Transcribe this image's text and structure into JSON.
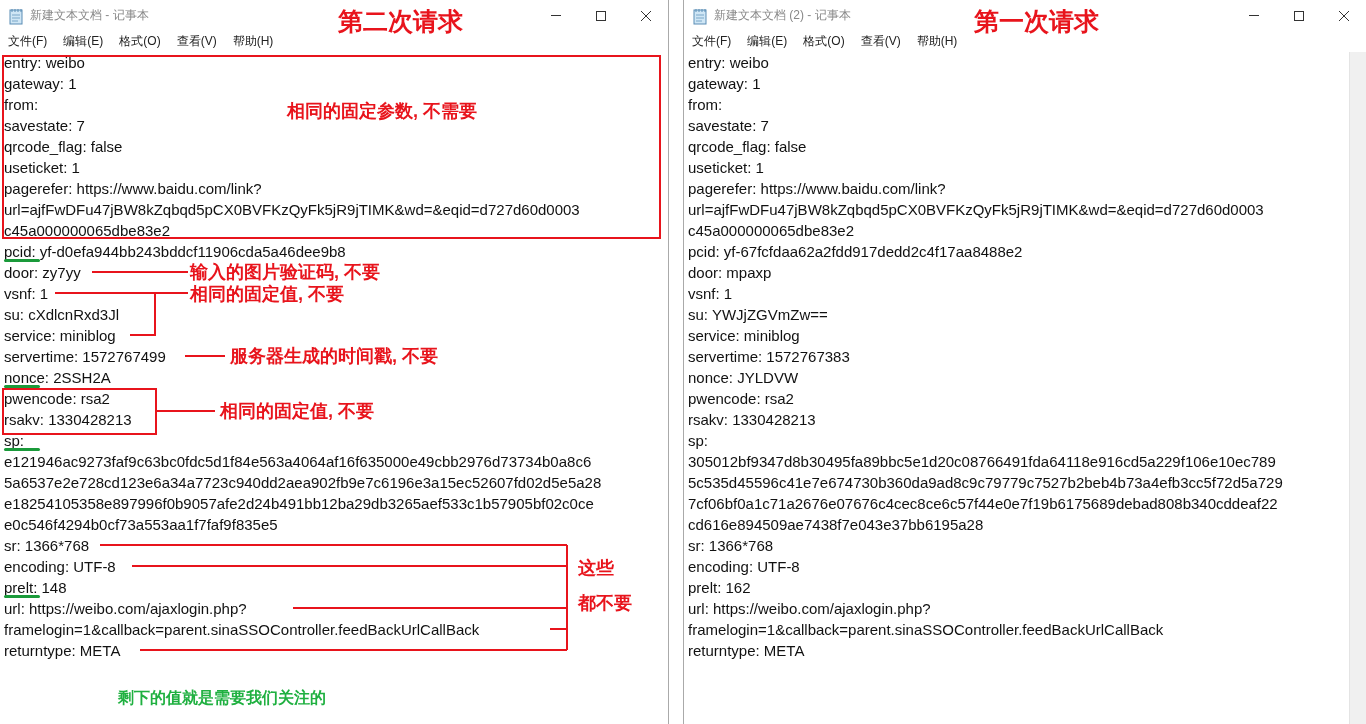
{
  "windows": [
    {
      "title": "新建文本文档 - 记事本",
      "heading": "第二次请求",
      "menu": [
        "文件(F)",
        "编辑(E)",
        "格式(O)",
        "查看(V)",
        "帮助(H)"
      ],
      "lines": [
        {
          "text": "entry: weibo",
          "underlined": false
        },
        {
          "text": "gateway: 1",
          "underlined": false
        },
        {
          "text": "from:",
          "underlined": false
        },
        {
          "text": "savestate: 7",
          "underlined": false
        },
        {
          "text": "qrcode_flag: false",
          "underlined": false
        },
        {
          "text": "useticket: 1",
          "underlined": false
        },
        {
          "text": "pagerefer: https://www.baidu.com/link?",
          "underlined": false
        },
        {
          "text": "url=ajfFwDFu47jBW8kZqbqd5pCX0BVFKzQyFk5jR9jTIMK&wd=&eqid=d727d60d0003",
          "underlined": false
        },
        {
          "text": "c45a000000065dbe83e2",
          "underlined": false
        },
        {
          "text": "pcid: yf-d0efa944bb243bddcf11906cda5a46dee9b8",
          "underlined": true
        },
        {
          "text": "door: zy7yy",
          "underlined": false
        },
        {
          "text": "vsnf: 1",
          "underlined": false
        },
        {
          "text": "su: cXdlcnRxd3Jl",
          "underlined": false
        },
        {
          "text": "service: miniblog",
          "underlined": false
        },
        {
          "text": "servertime: 1572767499",
          "underlined": false
        },
        {
          "text": "nonce: 2SSH2A",
          "underlined": true
        },
        {
          "text": "pwencode: rsa2",
          "underlined": false
        },
        {
          "text": "rsakv: 1330428213",
          "underlined": false
        },
        {
          "text": "sp:",
          "underlined": true
        },
        {
          "text": "e121946ac9273faf9c63bc0fdc5d1f84e563a4064af16f635000e49cbb2976d73734b0a8c6",
          "underlined": false
        },
        {
          "text": "5a6537e2e728cd123e6a34a7723c940dd2aea902fb9e7c6196e3a15ec52607fd02d5e5a28",
          "underlined": false
        },
        {
          "text": "e18254105358e897996f0b9057afe2d24b491bb12ba29db3265aef533c1b57905bf02c0ce",
          "underlined": false
        },
        {
          "text": "e0c546f4294b0cf73a553aa1f7faf9f835e5",
          "underlined": false
        },
        {
          "text": "sr: 1366*768",
          "underlined": false
        },
        {
          "text": "encoding: UTF-8",
          "underlined": false
        },
        {
          "text": "prelt: 148",
          "underlined": true
        },
        {
          "text": "url: https://weibo.com/ajaxlogin.php?",
          "underlined": false
        },
        {
          "text": "framelogin=1&callback=parent.sinaSSOController.feedBackUrlCallBack",
          "underlined": false
        },
        {
          "text": "returntype: META",
          "underlined": false
        }
      ],
      "annotations": [
        {
          "kind": "label",
          "text": "相同的固定参数, 不需要"
        },
        {
          "kind": "label",
          "text": "输入的图片验证码, 不要"
        },
        {
          "kind": "label",
          "text": "相同的固定值, 不要"
        },
        {
          "kind": "label",
          "text": "服务器生成的时间戳, 不要"
        },
        {
          "kind": "label",
          "text": "相同的固定值, 不要"
        },
        {
          "kind": "label",
          "text": "这些"
        },
        {
          "kind": "label",
          "text": "都不要"
        },
        {
          "kind": "note",
          "text": "剩下的值就是需要我们关注的"
        }
      ]
    },
    {
      "title": "新建文本文档 (2) - 记事本",
      "heading": "第一次请求",
      "menu": [
        "文件(F)",
        "编辑(E)",
        "格式(O)",
        "查看(V)",
        "帮助(H)"
      ],
      "lines": [
        {
          "text": "entry: weibo",
          "underlined": false
        },
        {
          "text": "gateway: 1",
          "underlined": false
        },
        {
          "text": "from:",
          "underlined": false
        },
        {
          "text": "savestate: 7",
          "underlined": false
        },
        {
          "text": "qrcode_flag: false",
          "underlined": false
        },
        {
          "text": "useticket: 1",
          "underlined": false
        },
        {
          "text": "pagerefer: https://www.baidu.com/link?",
          "underlined": false
        },
        {
          "text": "url=ajfFwDFu47jBW8kZqbqd5pCX0BVFKzQyFk5jR9jTIMK&wd=&eqid=d727d60d0003",
          "underlined": false
        },
        {
          "text": "c45a000000065dbe83e2",
          "underlined": false
        },
        {
          "text": "pcid: yf-67fcfdaa62a2fdd917dedd2c4f17aa8488e2",
          "underlined": false
        },
        {
          "text": "door: mpaxp",
          "underlined": false
        },
        {
          "text": "vsnf: 1",
          "underlined": false
        },
        {
          "text": "su: YWJjZGVmZw==",
          "underlined": false
        },
        {
          "text": "service: miniblog",
          "underlined": false
        },
        {
          "text": "servertime: 1572767383",
          "underlined": false
        },
        {
          "text": "nonce: JYLDVW",
          "underlined": false
        },
        {
          "text": "pwencode: rsa2",
          "underlined": false
        },
        {
          "text": "rsakv: 1330428213",
          "underlined": false
        },
        {
          "text": "sp:",
          "underlined": false
        },
        {
          "text": "305012bf9347d8b30495fa89bbc5e1d20c08766491fda64118e916cd5a229f106e10ec789",
          "underlined": false
        },
        {
          "text": "5c535d45596c41e7e674730b360da9ad8c9c79779c7527b2beb4b73a4efb3cc5f72d5a729",
          "underlined": false
        },
        {
          "text": "7cf06bf0a1c71a2676e07676c4cec8ce6c57f44e0e7f19b6175689debad808b340cddeaf22",
          "underlined": false
        },
        {
          "text": "cd616e894509ae7438f7e043e37bb6195a28",
          "underlined": false
        },
        {
          "text": "sr: 1366*768",
          "underlined": false
        },
        {
          "text": "encoding: UTF-8",
          "underlined": false
        },
        {
          "text": "prelt: 162",
          "underlined": false
        },
        {
          "text": "url: https://weibo.com/ajaxlogin.php?",
          "underlined": false
        },
        {
          "text": "framelogin=1&callback=parent.sinaSSOController.feedBackUrlCallBack",
          "underlined": false
        },
        {
          "text": "returntype: META",
          "underlined": false
        }
      ]
    }
  ]
}
